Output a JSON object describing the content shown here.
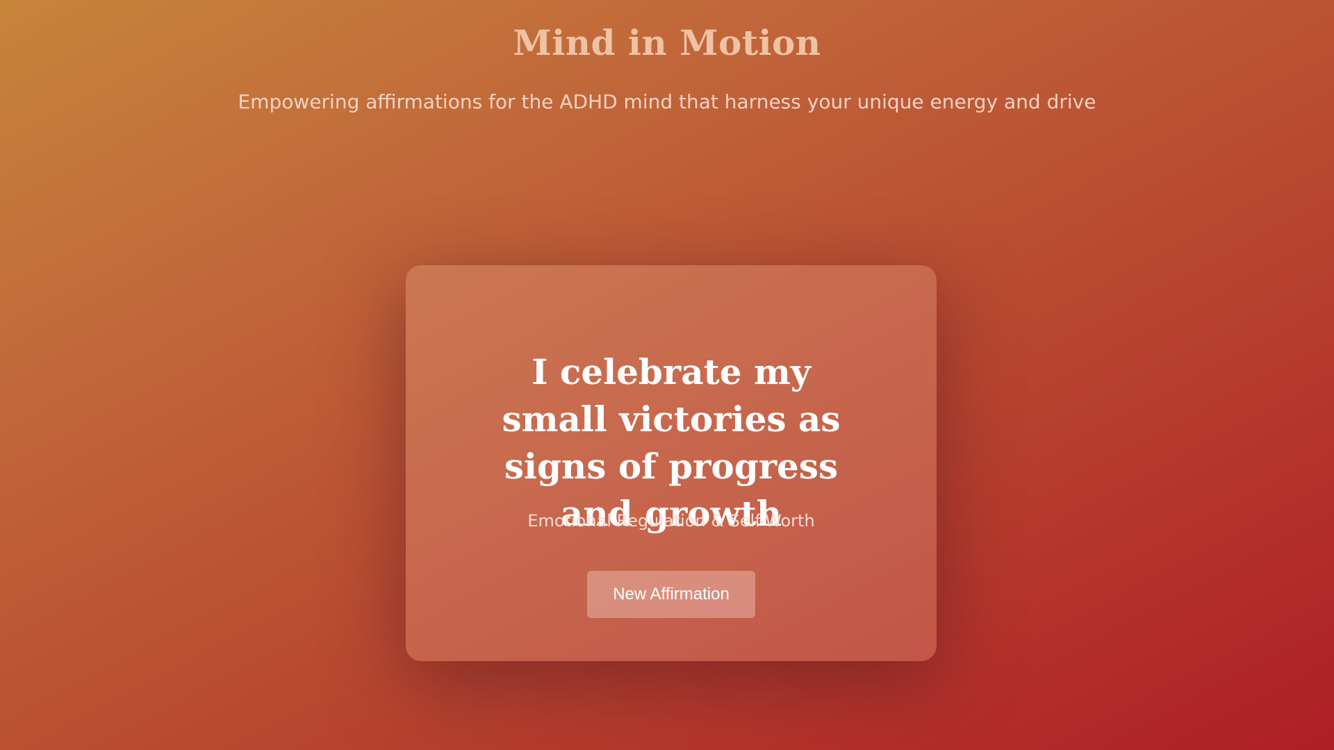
{
  "header": {
    "title": "Mind in Motion",
    "subtitle": "Empowering affirmations for the ADHD mind that harness your unique energy and drive"
  },
  "affirmation": {
    "text": "I celebrate my small victories as signs of progress and growth",
    "category": "Emotional Regulation & Self-Worth"
  },
  "actions": {
    "new_affirmation_label": "New Affirmation"
  },
  "colors": {
    "background_start": "#c8843b",
    "background_end": "#ae1e25",
    "title": "#f0c2a4",
    "text": "#ffffff"
  }
}
